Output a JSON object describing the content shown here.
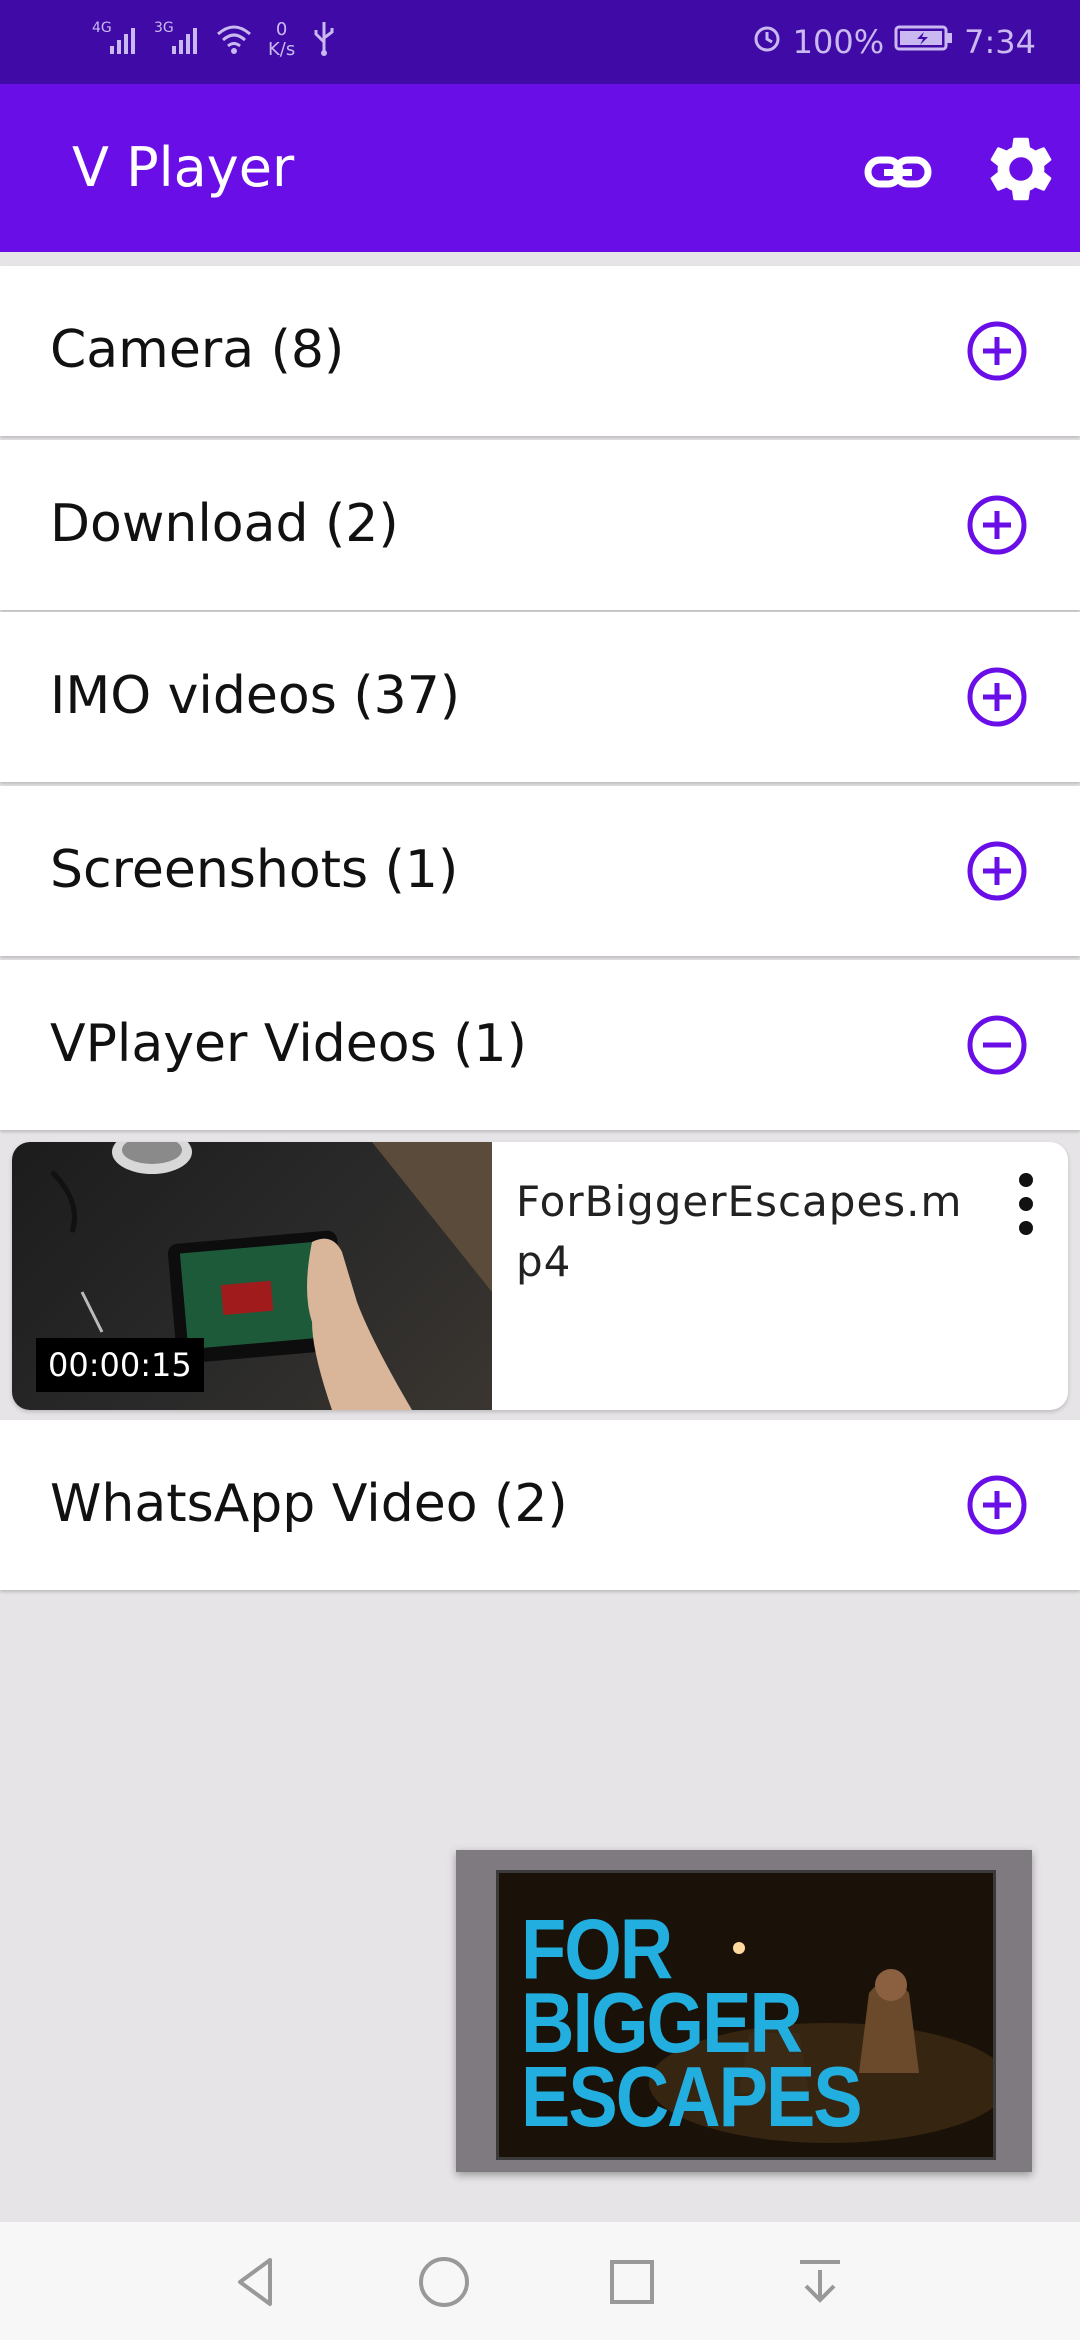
{
  "status_bar": {
    "network1": "4G",
    "network2": "3G",
    "speed_value": "0",
    "speed_unit": "K/s",
    "battery": "100%",
    "time": "7:34"
  },
  "app_bar": {
    "title": "V Player",
    "link_icon": "link-icon",
    "settings_icon": "gear-icon"
  },
  "folders": [
    {
      "label": "Camera (8)",
      "icon": "plus-circle-icon"
    },
    {
      "label": "Download (2)",
      "icon": "plus-circle-icon"
    },
    {
      "label": "IMO videos (37)",
      "icon": "plus-circle-icon"
    },
    {
      "label": "Screenshots (1)",
      "icon": "plus-circle-icon"
    },
    {
      "label": "VPlayer Videos (1)",
      "icon": "minus-circle-icon"
    },
    {
      "label": "WhatsApp Video (2)",
      "icon": "plus-circle-icon"
    }
  ],
  "video_item": {
    "duration": "00:00:15",
    "filename": "ForBiggerEscapes.mp4"
  },
  "mini_player": {
    "title_lines": [
      "FOR",
      "BIGGER",
      "ESCAPES"
    ]
  },
  "colors": {
    "status_bar": "#3f0aa6",
    "app_bar": "#6a0ee8",
    "accent": "#6a0ee8",
    "background": "#e6e4e6"
  }
}
